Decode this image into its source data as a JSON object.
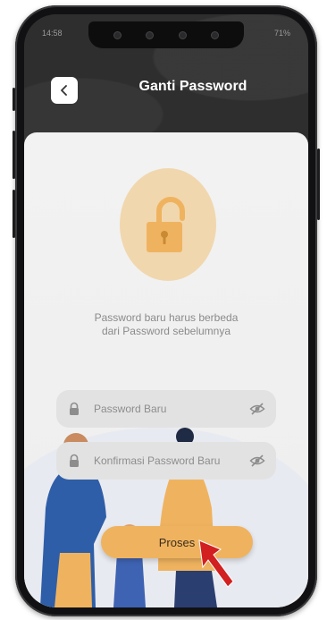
{
  "status_bar": {
    "time": "14:58",
    "battery": "71%"
  },
  "header": {
    "title": "Ganti Password"
  },
  "message": {
    "line1": "Password baru harus berbeda",
    "line2": "dari Password sebelumnya"
  },
  "fields": {
    "new_password_placeholder": "Password Baru",
    "confirm_password_placeholder": "Konfirmasi Password Baru"
  },
  "actions": {
    "submit_label": "Proses"
  },
  "colors": {
    "accent": "#efb35f",
    "lock_circle": "#f1d7ae",
    "header_bg": "#2e2e2e",
    "field_bg": "#e2e2e2",
    "annotation_arrow": "#d21f1f"
  },
  "icons": {
    "back": "chevron-left-icon",
    "lock_hero": "padlock-open-icon",
    "field_lock": "lock-icon",
    "visibility": "eye-off-icon"
  }
}
